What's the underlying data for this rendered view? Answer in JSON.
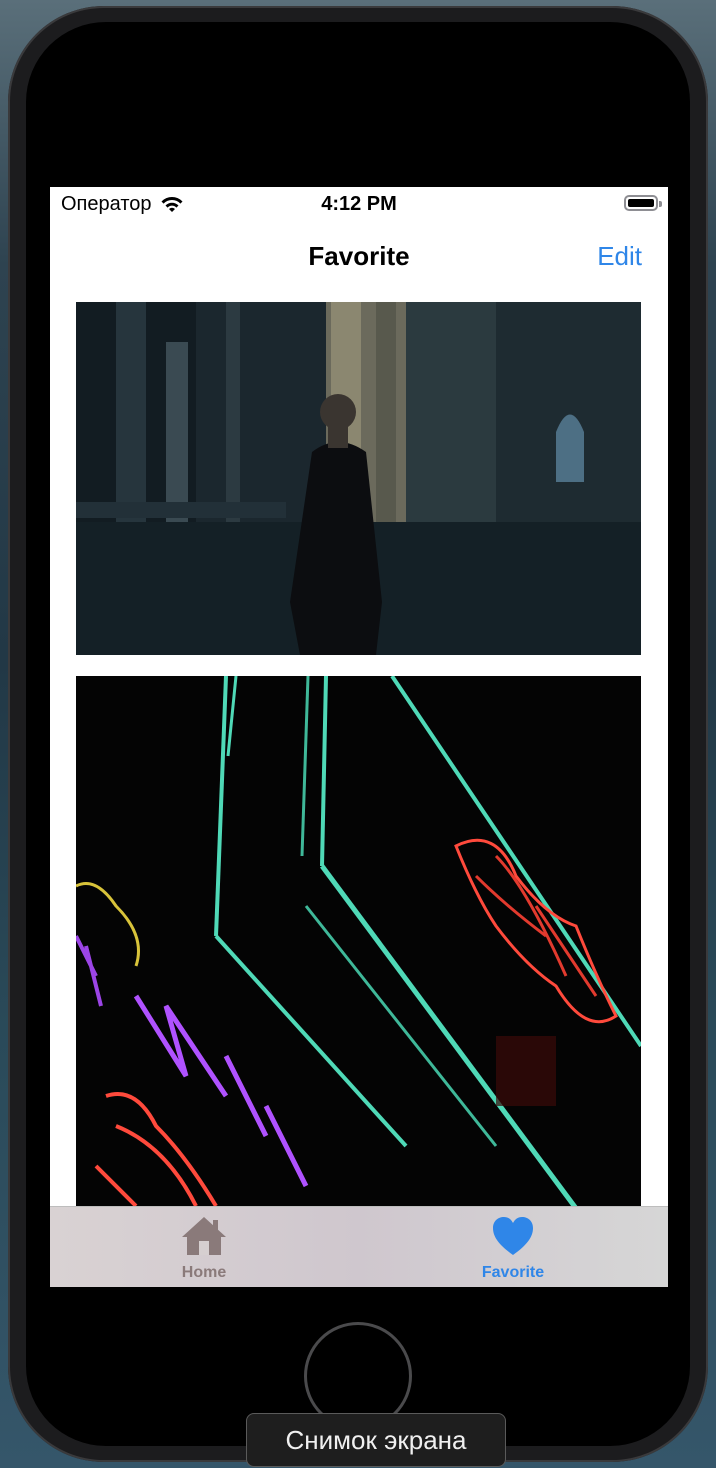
{
  "status_bar": {
    "carrier": "Оператор",
    "time": "4:12 PM"
  },
  "nav_bar": {
    "title": "Favorite",
    "edit_label": "Edit"
  },
  "tab_bar": {
    "tabs": [
      {
        "label": "Home",
        "icon": "house-icon",
        "selected": false
      },
      {
        "label": "Favorite",
        "icon": "heart-icon",
        "selected": true
      }
    ]
  },
  "tooltip": {
    "text": "Снимок экрана"
  },
  "colors": {
    "accent": "#2f86e8",
    "inactive_tab": "#8a7a7a"
  }
}
